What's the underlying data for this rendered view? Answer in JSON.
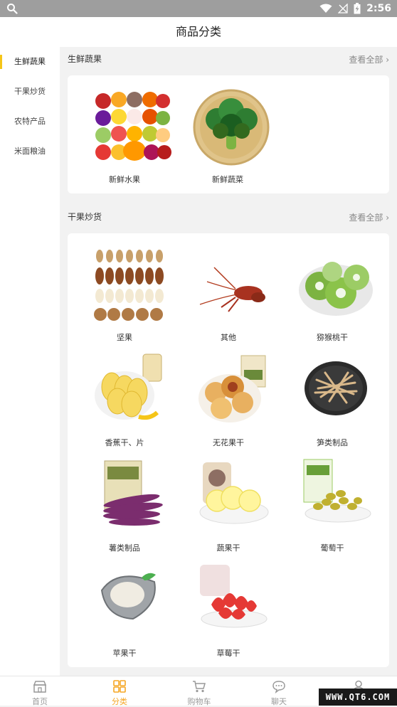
{
  "status_bar": {
    "time": "2:56"
  },
  "header": {
    "title": "商品分类"
  },
  "sidebar": {
    "items": [
      {
        "label": "生鲜蔬果",
        "active": true
      },
      {
        "label": "干果炒货",
        "active": false
      },
      {
        "label": "农特产品",
        "active": false
      },
      {
        "label": "米面粮油",
        "active": false
      }
    ]
  },
  "sections": [
    {
      "title": "生鲜蔬果",
      "more": "查看全部",
      "items": [
        {
          "label": "新鲜水果",
          "icon": "fruit-platter"
        },
        {
          "label": "新鲜蔬菜",
          "icon": "broccoli"
        }
      ]
    },
    {
      "title": "干果炒货",
      "more": "查看全部",
      "items": [
        {
          "label": "坚果",
          "icon": "nuts"
        },
        {
          "label": "其他",
          "icon": "lobster"
        },
        {
          "label": "猕猴桃干",
          "icon": "kiwi"
        },
        {
          "label": "香蕉干、片",
          "icon": "banana-chips"
        },
        {
          "label": "无花果干",
          "icon": "figs"
        },
        {
          "label": "笋类制品",
          "icon": "bamboo-shoots"
        },
        {
          "label": "薯类制品",
          "icon": "sweet-potato"
        },
        {
          "label": "蔬果干",
          "icon": "lemon-slices"
        },
        {
          "label": "葡萄干",
          "icon": "raisins"
        },
        {
          "label": "苹果干",
          "icon": "oyster"
        },
        {
          "label": "草莓干",
          "icon": "strawberries"
        }
      ]
    }
  ],
  "tabbar": {
    "items": [
      {
        "label": "首页",
        "active": false
      },
      {
        "label": "分类",
        "active": true
      },
      {
        "label": "购物车",
        "active": false
      },
      {
        "label": "聊天",
        "active": false
      },
      {
        "label": "",
        "active": false
      }
    ]
  },
  "watermark": "WWW.QT6.COM",
  "colors": {
    "accent": "#f5c518",
    "tab_active": "#f5a623",
    "background": "#f2f2f2"
  }
}
